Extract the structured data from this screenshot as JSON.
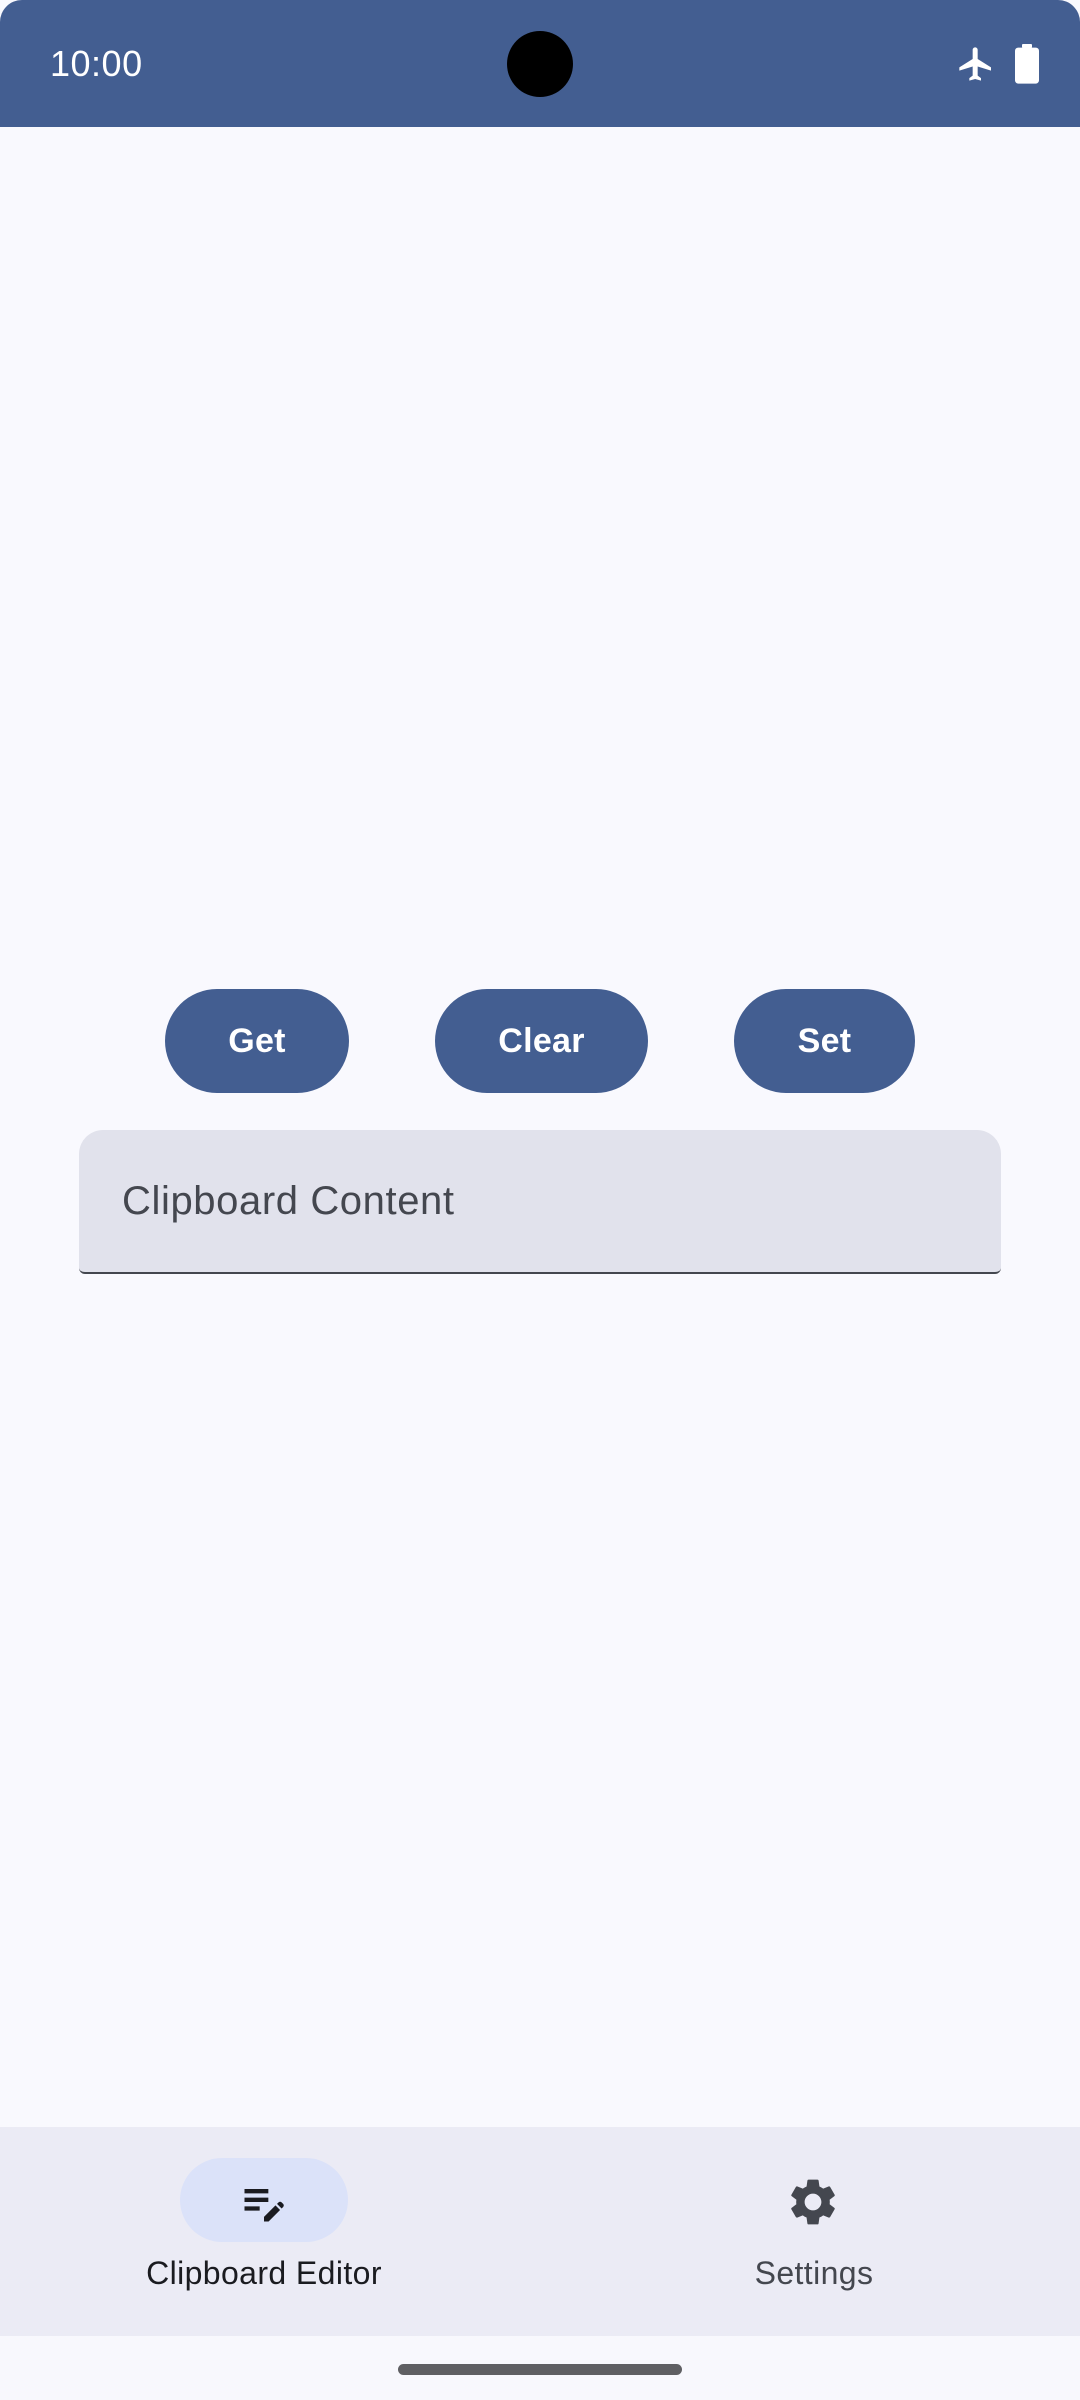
{
  "status_bar": {
    "time": "10:00",
    "icons": [
      "airplane-mode-icon",
      "battery-icon"
    ]
  },
  "actions": {
    "get_label": "Get",
    "clear_label": "Clear",
    "set_label": "Set"
  },
  "clipboard_field": {
    "label": "Clipboard Content",
    "value": ""
  },
  "bottom_nav": {
    "items": [
      {
        "label": "Clipboard Editor",
        "icon": "edit-note-icon",
        "selected": true
      },
      {
        "label": "Settings",
        "icon": "gear-icon",
        "selected": false
      }
    ]
  },
  "colors": {
    "primary": "#435e91",
    "background": "#f9f9fe",
    "field_background": "#e1e2ec",
    "nav_background": "#ebebf5",
    "nav_indicator": "#dbe2f9",
    "on_surface": "#1a1b20",
    "on_surface_variant": "#44474f"
  }
}
